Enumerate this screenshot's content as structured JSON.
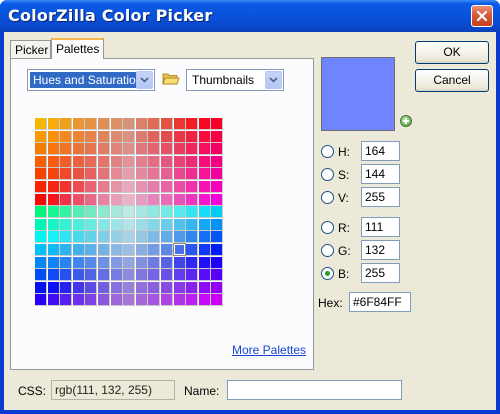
{
  "window": {
    "title": "ColorZilla Color Picker"
  },
  "tabs": [
    {
      "label": "Picker",
      "active": false
    },
    {
      "label": "Palettes",
      "active": true
    }
  ],
  "palette_panel": {
    "palette_select": {
      "value": "Hues and Saturations"
    },
    "view_select": {
      "value": "Thumbnails"
    },
    "more_link": "More Palettes",
    "grid": {
      "rows": 15,
      "cols": 15,
      "selected_row": 10,
      "selected_col": 11
    }
  },
  "buttons": {
    "ok": "OK",
    "cancel": "Cancel"
  },
  "current_color": {
    "hex_value": "#6F84FF",
    "swatch_color": "#6f84ff"
  },
  "hsv": [
    {
      "label": "H:",
      "value": "164",
      "checked": false
    },
    {
      "label": "S:",
      "value": "144",
      "checked": false
    },
    {
      "label": "V:",
      "value": "255",
      "checked": false
    }
  ],
  "rgb": [
    {
      "label": "R:",
      "value": "111",
      "checked": false
    },
    {
      "label": "G:",
      "value": "132",
      "checked": false
    },
    {
      "label": "B:",
      "value": "255",
      "checked": true
    }
  ],
  "hex": {
    "label": "Hex:",
    "value": "#6F84FF"
  },
  "css": {
    "label": "CSS:",
    "value": "rgb(111, 132, 255)"
  },
  "name": {
    "label": "Name:",
    "value": ""
  },
  "colors": {
    "title_bar": "#0a52dc",
    "dialog_bg": "#ece9d8",
    "link": "#1744cf",
    "selection": "#316ac5"
  }
}
